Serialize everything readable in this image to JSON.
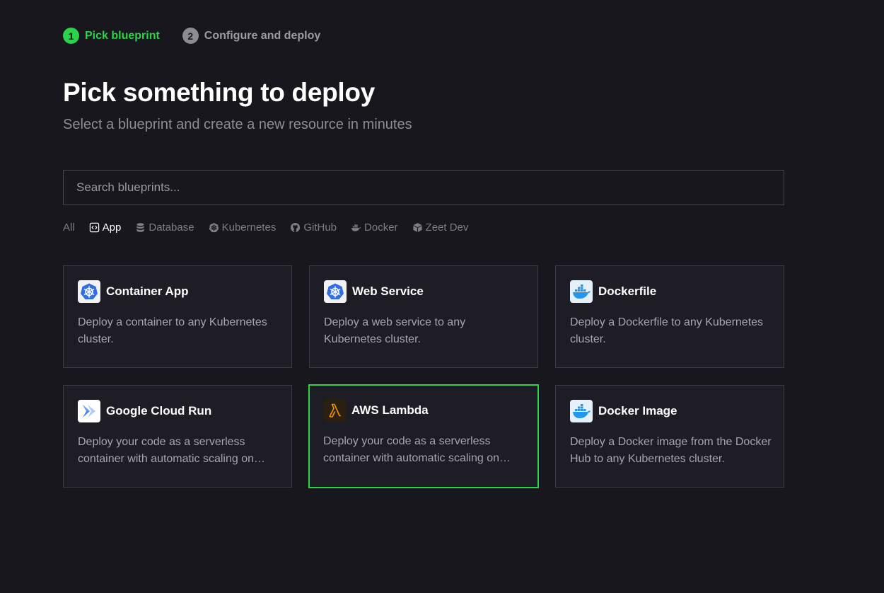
{
  "colors": {
    "accent": "#2ad349",
    "background": "#18171d",
    "card": "#1e1d25"
  },
  "steps": [
    {
      "number": "1",
      "label": "Pick blueprint",
      "state": "active"
    },
    {
      "number": "2",
      "label": "Configure and deploy",
      "state": "inactive"
    }
  ],
  "header": {
    "title": "Pick something to deploy",
    "subtitle": "Select a blueprint and create a new resource in minutes"
  },
  "search": {
    "placeholder": "Search blueprints...",
    "value": ""
  },
  "filters": [
    {
      "label": "All",
      "icon": "none",
      "active": false
    },
    {
      "label": "App",
      "icon": "code-icon",
      "active": true
    },
    {
      "label": "Database",
      "icon": "database-icon",
      "active": false
    },
    {
      "label": "Kubernetes",
      "icon": "kubernetes-icon",
      "active": false
    },
    {
      "label": "GitHub",
      "icon": "github-icon",
      "active": false
    },
    {
      "label": "Docker",
      "icon": "docker-icon",
      "active": false
    },
    {
      "label": "Zeet Dev",
      "icon": "box-icon",
      "active": false
    }
  ],
  "blueprints": [
    {
      "name": "Container App",
      "icon": "kubernetes-icon",
      "description": "Deploy a container to any Kubernetes cluster.",
      "selected": false
    },
    {
      "name": "Web Service",
      "icon": "kubernetes-icon",
      "description": "Deploy a web service to any Kubernetes cluster.",
      "selected": false
    },
    {
      "name": "Dockerfile",
      "icon": "docker-icon",
      "description": "Deploy a Dockerfile to any Kubernetes cluster.",
      "selected": false
    },
    {
      "name": "Google Cloud Run",
      "icon": "google-cloud-run-icon",
      "description": "Deploy your code as a serverless container with automatic scaling on Google Cloud.",
      "selected": false
    },
    {
      "name": "AWS Lambda",
      "icon": "aws-lambda-icon",
      "description": "Deploy your code as a serverless container with automatic scaling on AWS.",
      "selected": true
    },
    {
      "name": "Docker Image",
      "icon": "docker-icon",
      "description": "Deploy a Docker image from the Docker Hub to any Kubernetes cluster.",
      "selected": false
    }
  ]
}
